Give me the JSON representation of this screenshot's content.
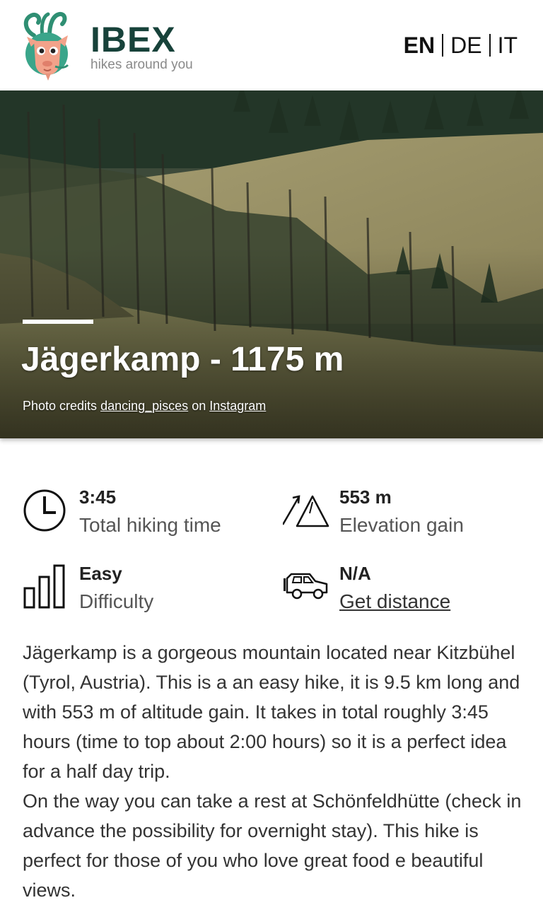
{
  "brand": {
    "name": "IBEX",
    "tagline": "hikes around you"
  },
  "languages": [
    {
      "code": "EN",
      "active": true
    },
    {
      "code": "DE",
      "active": false
    },
    {
      "code": "IT",
      "active": false
    }
  ],
  "hero": {
    "title": "Jägerkamp - 1175 m",
    "credits_prefix": "Photo credits",
    "credits_user": "dancing_pisces",
    "credits_on": "on",
    "credits_platform": "Instagram"
  },
  "stats": {
    "time": {
      "value": "3:45",
      "label": "Total hiking time",
      "icon": "clock-icon"
    },
    "elevation": {
      "value": "553 m",
      "label": "Elevation gain",
      "icon": "mountain-icon"
    },
    "difficulty": {
      "value": "Easy",
      "label": "Difficulty",
      "icon": "signal-bars-icon"
    },
    "distance": {
      "value": "N/A",
      "label": "Get distance",
      "icon": "car-icon"
    }
  },
  "description": {
    "p1": "Jägerkamp is a gorgeous mountain located near Kitzbühel (Tyrol, Austria). This is a an easy hike, it is 9.5 km long and with 553 m of altitude gain. It takes in total roughly 3:45 hours (time to top about 2:00 hours) so it is a perfect idea for a half day trip.",
    "p2": "On the way you can take a rest at Schönfeldhütte (check in advance the possibility for overnight stay). This hike is perfect for those of you who love great food e beautiful views."
  },
  "colors": {
    "brand": "#17423a",
    "logo_teal": "#2f8f73",
    "logo_pink": "#f2a28a"
  }
}
